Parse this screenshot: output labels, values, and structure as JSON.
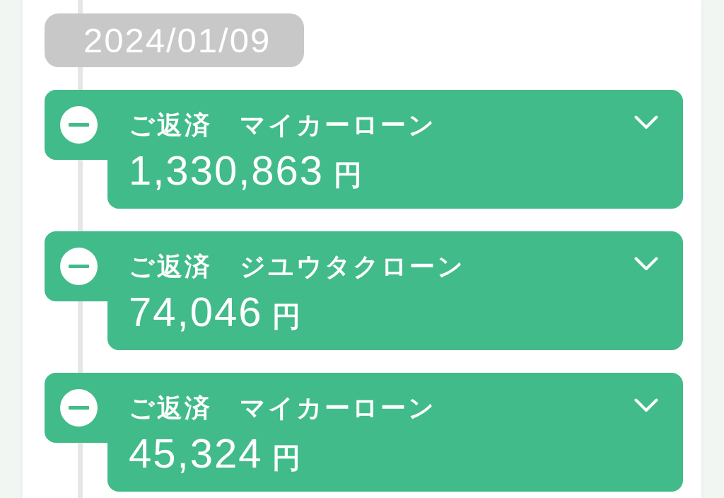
{
  "date": "2024/01/09",
  "entries": [
    {
      "title": "ご返済　マイカーローン",
      "amount": "1,330,863",
      "unit": "円",
      "expanded": false
    },
    {
      "title": "ご返済　ジユウタクローン",
      "amount": "74,046",
      "unit": "円",
      "expanded": false
    },
    {
      "title": "ご返済　マイカーローン",
      "amount": "45,324",
      "unit": "円",
      "expanded": false
    }
  ]
}
